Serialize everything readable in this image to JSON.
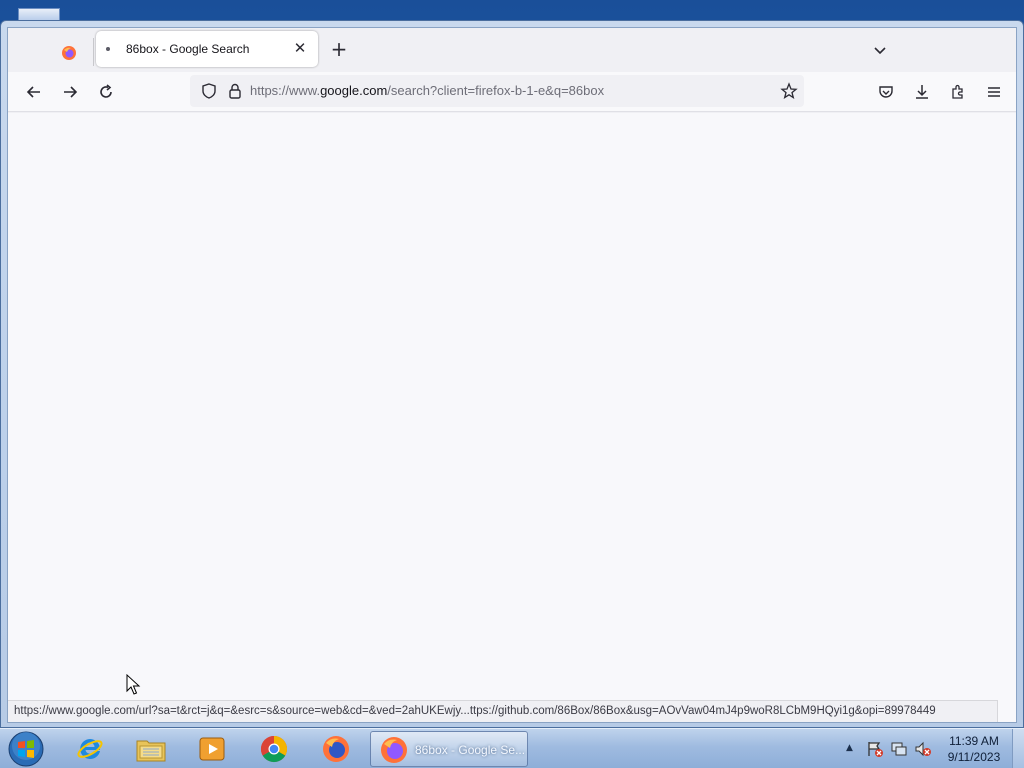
{
  "browser": {
    "tabs": [
      {
        "title": "86box - Google Search",
        "active": true
      }
    ],
    "toolbar": {
      "url_prefix": "https://www.",
      "url_domain": "google.com",
      "url_path": "/search?client=firefox-b-1-e&q=86box"
    },
    "status_text": "https://www.google.com/url?sa=t&rct=j&q=&esrc=s&source=web&cd=&ved=2ahUKEwjy...ttps://github.com/86Box/86Box&usg=AOvVaw04mJ4p9woR8LCbM9HQyi1g&opi=89978449"
  },
  "taskbar": {
    "active_window_label": "86box - Google Se...",
    "pinned": [
      "internet-explorer",
      "windows-explorer",
      "media-player",
      "chrome",
      "firefox"
    ]
  },
  "clock": {
    "time": "11:39 AM",
    "date": "9/11/2023"
  },
  "colors": {
    "accent": "#0060df",
    "taskbar": "#9fbbe0",
    "content_bg": "#f8f8fb"
  }
}
